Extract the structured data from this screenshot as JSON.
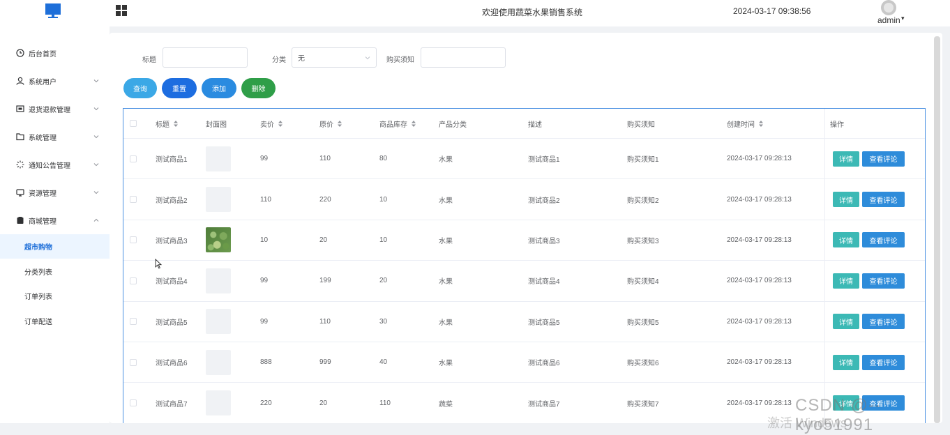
{
  "header": {
    "title": "欢迎使用蔬菜水果销售系统",
    "datetime": "2024-03-17 09:38:56",
    "user": "admin",
    "logo_icon": "monitor-icon",
    "menu_toggle_icon": "grid-icon",
    "accent_color": "#1e6fd9"
  },
  "sidebar": {
    "items": [
      {
        "label": "后台首页",
        "icon": "clock-icon"
      },
      {
        "label": "系统用户",
        "icon": "user-icon"
      },
      {
        "label": "退货退款管理",
        "icon": "return-icon"
      },
      {
        "label": "系统管理",
        "icon": "folder-icon"
      },
      {
        "label": "通知公告管理",
        "icon": "notice-icon"
      },
      {
        "label": "资源管理",
        "icon": "resource-icon"
      },
      {
        "label": "商城管理",
        "icon": "shop-icon"
      }
    ],
    "subitems": [
      "超市购物",
      "分类列表",
      "订单列表",
      "订单配送"
    ]
  },
  "filters": {
    "title_label": "标题",
    "title_value": "",
    "category_label": "分类",
    "category_value": "无",
    "notice_label": "购买须知",
    "notice_value": ""
  },
  "actions": {
    "search": "查询",
    "reset": "重置",
    "add": "添加",
    "delete": "删除"
  },
  "table": {
    "columns": [
      "标题",
      "封面图",
      "卖价",
      "原价",
      "商品库存",
      "产品分类",
      "描述",
      "购买须知",
      "创建时间",
      "操作"
    ],
    "detail_label": "详情",
    "comment_label": "查看评论",
    "rows": [
      {
        "title": "测试商品1",
        "price": "99",
        "orig": "110",
        "stock": "80",
        "cat": "水果",
        "desc": "测试商品1",
        "notice": "购买须知1",
        "created": "2024-03-17 09:28:13",
        "photo": false
      },
      {
        "title": "测试商品2",
        "price": "110",
        "orig": "220",
        "stock": "10",
        "cat": "水果",
        "desc": "测试商品2",
        "notice": "购买须知2",
        "created": "2024-03-17 09:28:13",
        "photo": false
      },
      {
        "title": "测试商品3",
        "price": "10",
        "orig": "20",
        "stock": "10",
        "cat": "水果",
        "desc": "测试商品3",
        "notice": "购买须知3",
        "created": "2024-03-17 09:28:13",
        "photo": true
      },
      {
        "title": "测试商品4",
        "price": "99",
        "orig": "199",
        "stock": "20",
        "cat": "水果",
        "desc": "测试商品4",
        "notice": "购买须知4",
        "created": "2024-03-17 09:28:13",
        "photo": false
      },
      {
        "title": "测试商品5",
        "price": "99",
        "orig": "110",
        "stock": "30",
        "cat": "水果",
        "desc": "测试商品5",
        "notice": "购买须知5",
        "created": "2024-03-17 09:28:13",
        "photo": false
      },
      {
        "title": "测试商品6",
        "price": "888",
        "orig": "999",
        "stock": "40",
        "cat": "水果",
        "desc": "测试商品6",
        "notice": "购买须知6",
        "created": "2024-03-17 09:28:13",
        "photo": false
      },
      {
        "title": "测试商品7",
        "price": "220",
        "orig": "20",
        "stock": "110",
        "cat": "蔬菜",
        "desc": "测试商品7",
        "notice": "购买须知7",
        "created": "2024-03-17 09:28:13",
        "photo": false
      }
    ]
  },
  "watermark": {
    "csdn": "CSDN @--kyo51991",
    "windows": "激活 Windows"
  }
}
